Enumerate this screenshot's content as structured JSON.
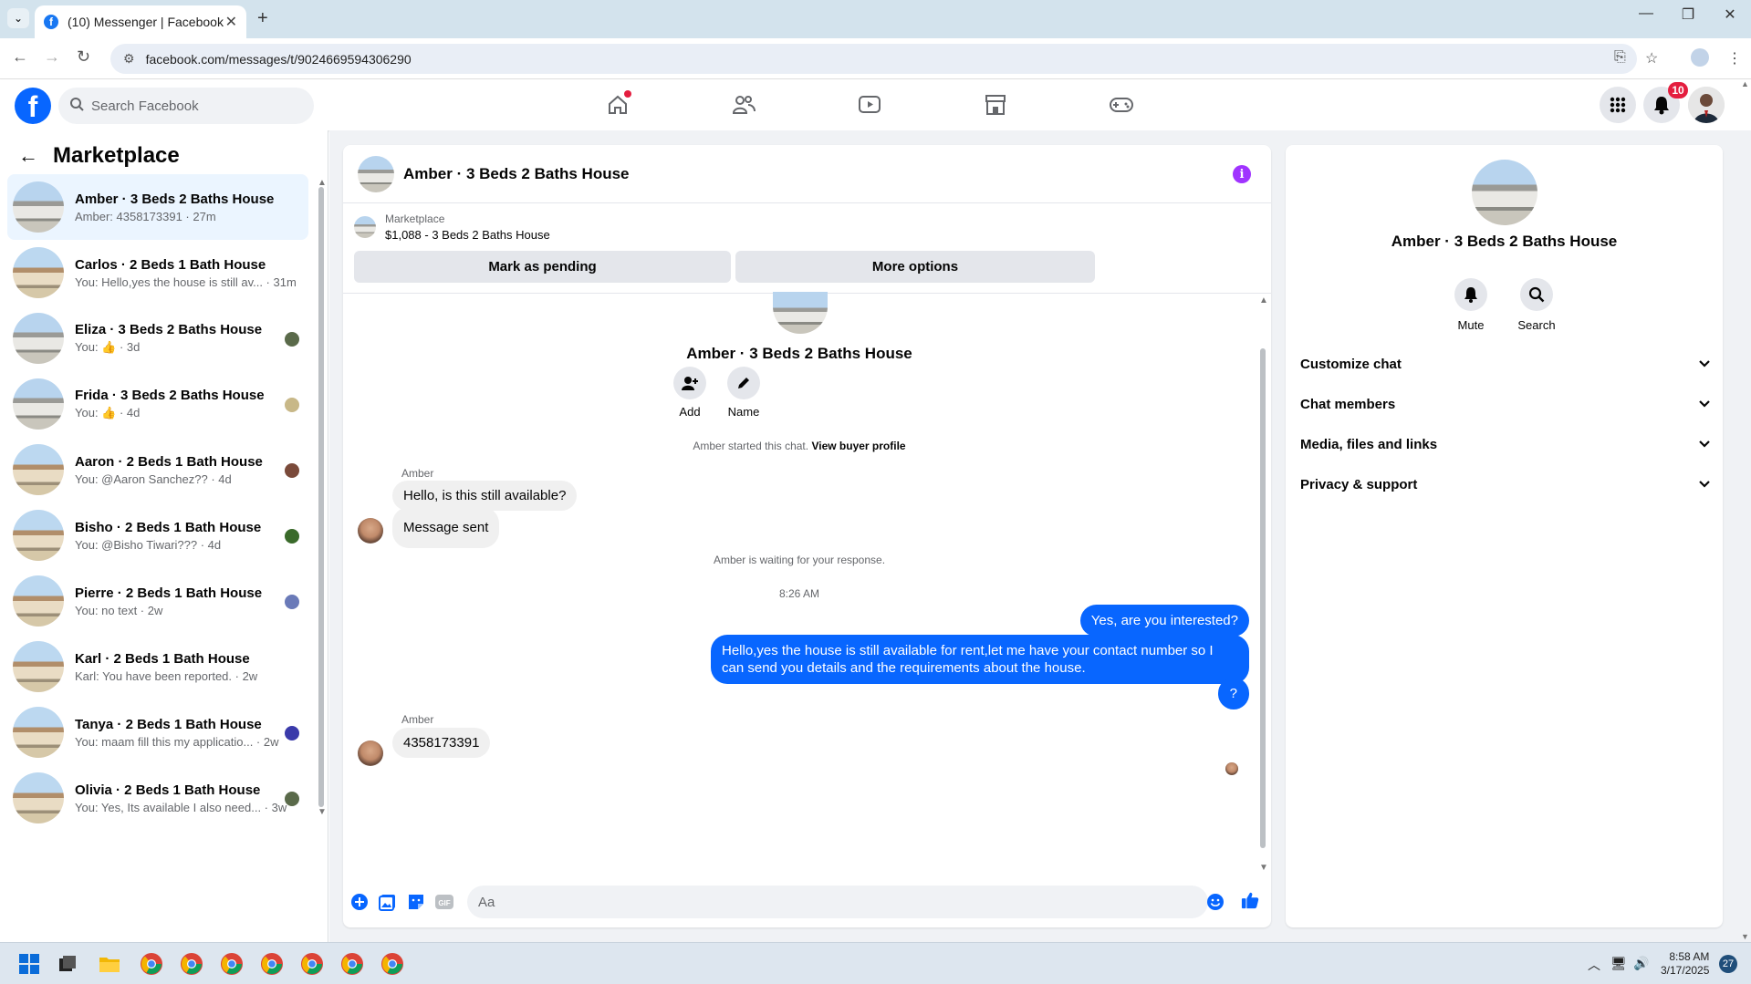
{
  "browser": {
    "tab_title": "(10) Messenger | Facebook",
    "url": "facebook.com/messages/t/9024669594306290"
  },
  "fb": {
    "search_placeholder": "Search Facebook",
    "notif_count": "10",
    "nav_icons": [
      "home-icon",
      "friends-icon",
      "watch-icon",
      "marketplace-icon",
      "gaming-icon"
    ]
  },
  "sidebar": {
    "title": "Marketplace",
    "conversations": [
      {
        "name": "Amber · 3 Beds 2 Baths House",
        "preview": "Amber: 4358173391 · 27m",
        "type": "modern"
      },
      {
        "name": "Carlos · 2 Beds 1 Bath House",
        "preview": "You: Hello,yes the house is still av... · 31m",
        "type": "cottage"
      },
      {
        "name": "Eliza · 3 Beds 2 Baths House",
        "preview": "You: 👍 · 3d",
        "type": "modern"
      },
      {
        "name": "Frida · 3 Beds 2 Baths House",
        "preview": "You: 👍 · 4d",
        "type": "modern"
      },
      {
        "name": "Aaron · 2 Beds 1 Bath House",
        "preview": "You: @Aaron Sanchez?? · 4d",
        "type": "cottage"
      },
      {
        "name": "Bisho · 2 Beds 1 Bath House",
        "preview": "You: @Bisho Tiwari??? · 4d",
        "type": "cottage"
      },
      {
        "name": "Pierre · 2 Beds 1 Bath House",
        "preview": "You: no text · 2w",
        "type": "cottage"
      },
      {
        "name": "Karl · 2 Beds 1 Bath House",
        "preview": "Karl: You have been reported. · 2w",
        "type": "cottage"
      },
      {
        "name": "Tanya · 2 Beds 1 Bath House",
        "preview": "You: maam fill this my applicatio... · 2w",
        "type": "cottage"
      },
      {
        "name": "Olivia · 2 Beds 1 Bath House",
        "preview": "You: Yes, Its available I also need... · 3w",
        "type": "cottage"
      }
    ]
  },
  "chat": {
    "title": "Amber · 3 Beds 2 Baths House",
    "listing_source": "Marketplace",
    "listing_desc": "$1,088 - 3 Beds 2 Baths House",
    "mark_pending": "Mark as pending",
    "more_options": "More options",
    "header_name": "Amber · 3 Beds 2 Baths House",
    "add_label": "Add",
    "name_label": "Name",
    "started_text": "Amber started this chat.",
    "view_buyer": "View buyer profile",
    "sender1": "Amber",
    "msg1": "Hello, is this still available?",
    "msg2": "Message sent",
    "waiting": "Amber is waiting for your response.",
    "time": "8:26 AM",
    "out1": "Yes, are you interested?",
    "out2": "Hello,yes the house is still available for rent,let me have your contact number   so I can send you details and the requirements about the house.",
    "out3": "?",
    "sender2": "Amber",
    "msg3": "4358173391",
    "composer_placeholder": "Aa"
  },
  "details": {
    "name": "Amber · 3 Beds 2 Baths House",
    "mute": "Mute",
    "search": "Search",
    "sections": [
      "Customize chat",
      "Chat members",
      "Media, files and links",
      "Privacy & support"
    ]
  },
  "taskbar": {
    "time": "8:58 AM",
    "date": "3/17/2025",
    "notifications": "27"
  }
}
